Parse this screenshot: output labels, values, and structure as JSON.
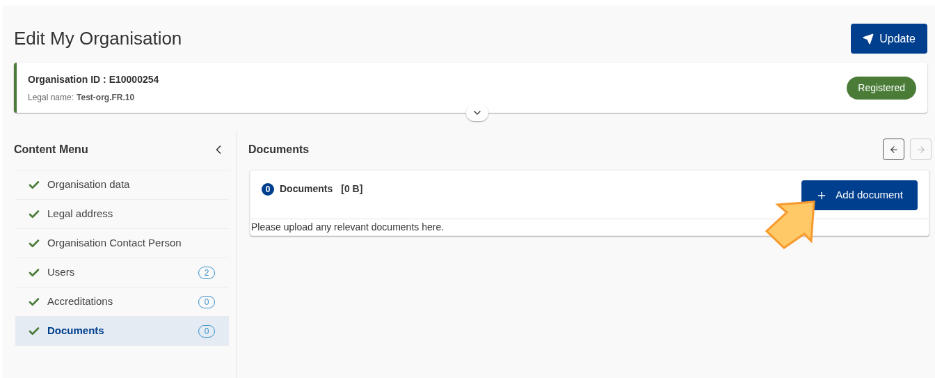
{
  "page": {
    "title": "Edit My Organisation",
    "update_button": "Update"
  },
  "organisation": {
    "id_label": "Organisation ID : E10000254",
    "legal_name_label": "Legal name:",
    "legal_name": "Test-org.FR.10",
    "status": "Registered"
  },
  "sidebar": {
    "title": "Content Menu",
    "items": [
      {
        "label": "Organisation data",
        "completed": true,
        "selected": false
      },
      {
        "label": "Legal address",
        "completed": true,
        "selected": false
      },
      {
        "label": "Organisation Contact Person",
        "completed": true,
        "selected": false
      },
      {
        "label": "Users",
        "completed": true,
        "selected": false,
        "count": "2"
      },
      {
        "label": "Accreditations",
        "completed": true,
        "selected": false,
        "count": "0"
      },
      {
        "label": "Documents",
        "completed": true,
        "selected": true,
        "count": "0"
      }
    ]
  },
  "main": {
    "title": "Documents",
    "nav": [
      {
        "kind": "previous",
        "disabled": false
      },
      {
        "kind": "next",
        "disabled": true
      }
    ],
    "documents": {
      "count": "0",
      "title": "Documents",
      "size": "[0 B]",
      "add_button": "Add document",
      "description": "Please upload any relevant documents here."
    }
  }
}
